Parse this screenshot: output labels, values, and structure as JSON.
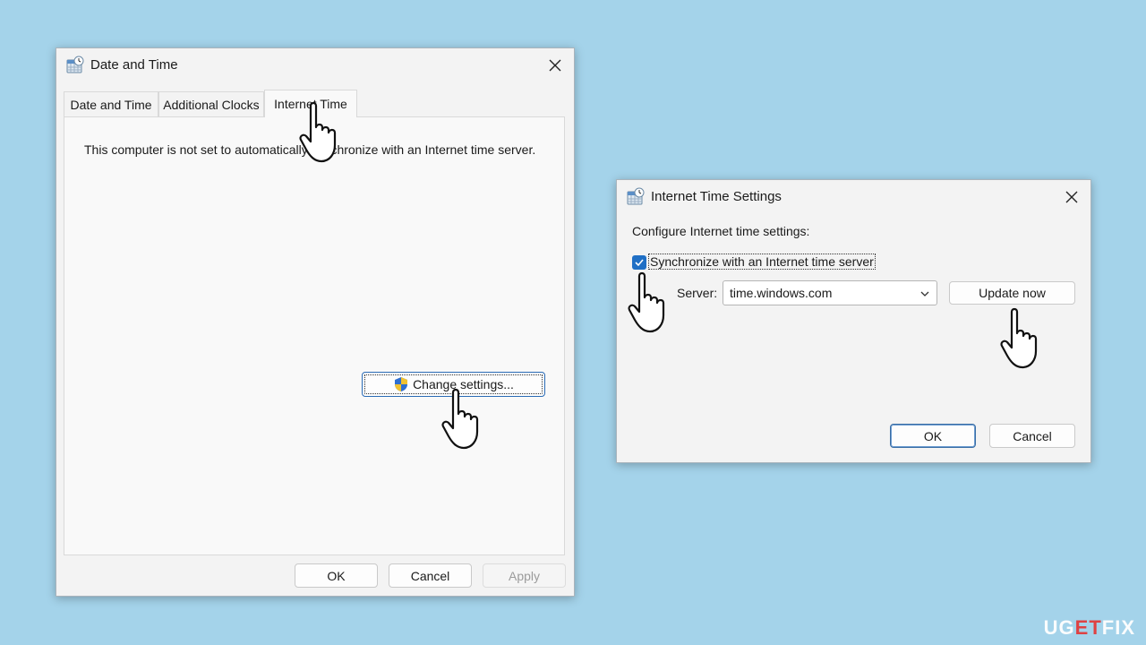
{
  "main_window": {
    "title": "Date and Time",
    "tabs": [
      {
        "label": "Date and Time",
        "active": false
      },
      {
        "label": "Additional Clocks",
        "active": false
      },
      {
        "label": "Internet Time",
        "active": true
      }
    ],
    "message": "This computer is not set to automatically synchronize with an Internet time server.",
    "change_settings_label": "Change settings...",
    "buttons": {
      "ok": "OK",
      "cancel": "Cancel",
      "apply": "Apply"
    }
  },
  "dialog": {
    "title": "Internet Time Settings",
    "heading": "Configure Internet time settings:",
    "sync_label": "Synchronize with an Internet time server",
    "sync_checked": true,
    "server_label": "Server:",
    "server_value": "time.windows.com",
    "update_now_label": "Update now",
    "buttons": {
      "ok": "OK",
      "cancel": "Cancel"
    }
  },
  "watermark": {
    "part1": "UG",
    "part2": "ET",
    "part3": "FIX"
  },
  "colors": {
    "background": "#a4d3ea",
    "accent": "#1f6fc5",
    "window": "#f3f3f3"
  },
  "icons": [
    "clock-icon",
    "close-icon",
    "shield-icon",
    "checkbox-check-icon",
    "chevron-down-icon",
    "hand-pointer-icon"
  ]
}
